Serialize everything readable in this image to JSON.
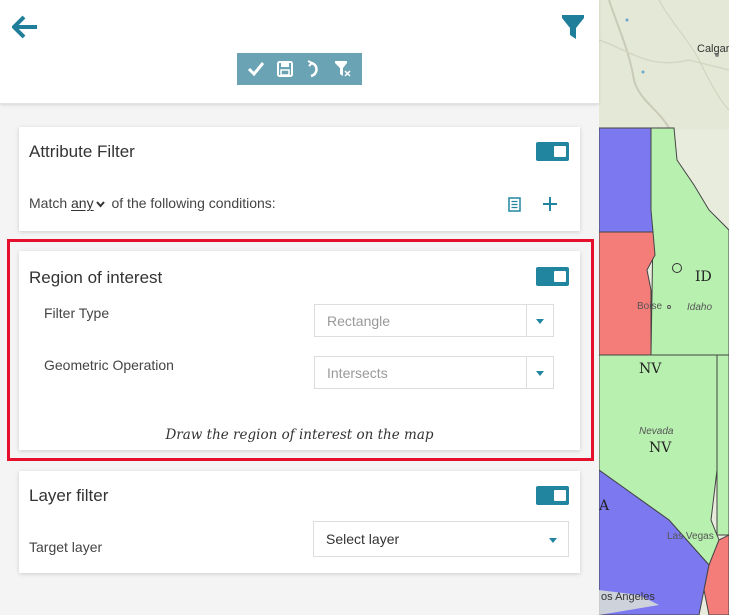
{
  "colors": {
    "accent": "#2185a0",
    "toolbar_bg": "#6aa3b4",
    "highlight": "#e5102b"
  },
  "topbar": {
    "back_icon": "arrow-left-icon",
    "filter_icon": "funnel-icon",
    "toolbar": [
      {
        "name": "apply-button",
        "icon": "check-icon"
      },
      {
        "name": "save-button",
        "icon": "floppy-disk-icon"
      },
      {
        "name": "undo-button",
        "icon": "undo-icon"
      },
      {
        "name": "clear-filter-button",
        "icon": "funnel-clear-icon"
      }
    ]
  },
  "attribute_filter": {
    "title": "Attribute Filter",
    "enabled": true,
    "match_prefix": "Match",
    "match_value": "any",
    "match_suffix": "of the following conditions:"
  },
  "region_of_interest": {
    "title": "Region of interest",
    "enabled": true,
    "filter_type_label": "Filter Type",
    "filter_type_value": "Rectangle",
    "geometric_operation_label": "Geometric Operation",
    "geometric_operation_value": "Intersects",
    "note": "Draw the region of interest on the map"
  },
  "layer_filter": {
    "title": "Layer filter",
    "enabled": true,
    "target_layer_label": "Target layer",
    "target_layer_value": "Select layer"
  },
  "map": {
    "labels": {
      "calgary": "Calgar",
      "id": "ID",
      "boise": "Boise",
      "idaho": "Idaho",
      "nv1": "NV",
      "nevada": "Nevada",
      "nv2": "NV",
      "ca": "A",
      "las_vegas": "Las Vegas",
      "los_angeles": "os Angeles"
    }
  }
}
